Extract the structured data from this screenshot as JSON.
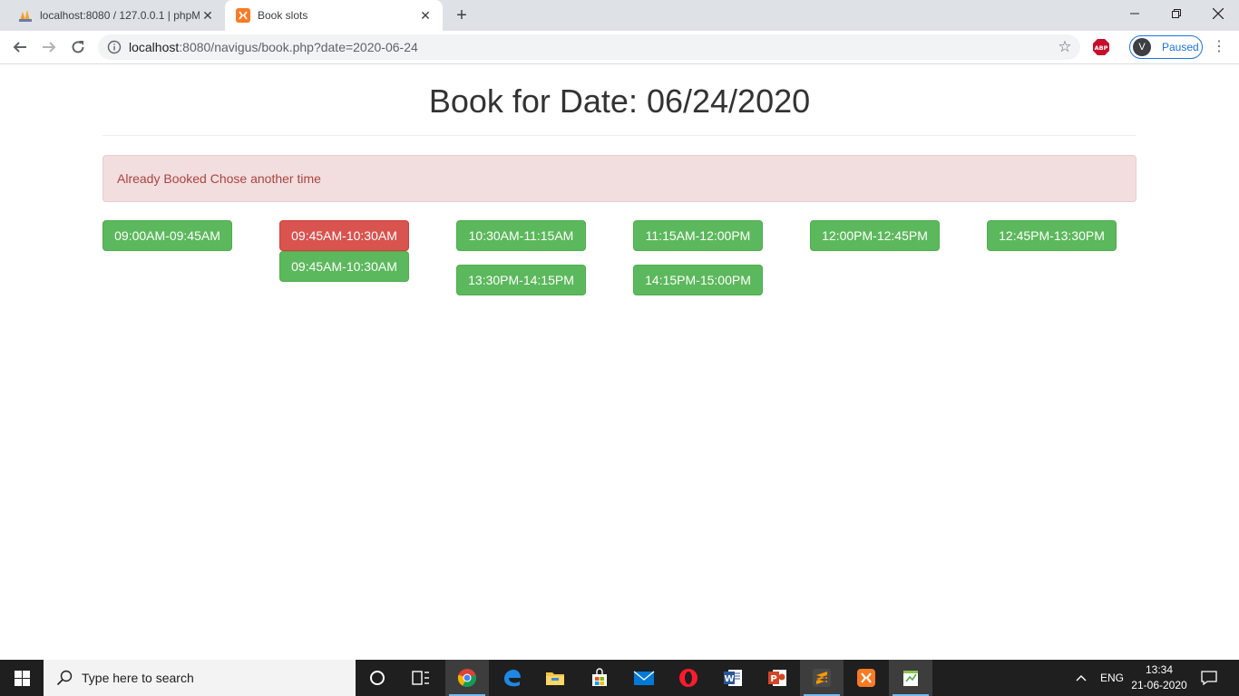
{
  "browser": {
    "tabs": [
      {
        "title": "localhost:8080 / 127.0.0.1 | phpMyAdmin",
        "active": false
      },
      {
        "title": "Book slots",
        "active": true
      }
    ],
    "url_host": "localhost",
    "url_rest": ":8080/navigus/book.php?date=2020-06-24",
    "profile_initial": "V",
    "profile_status": "Paused",
    "abp_label": "ABP"
  },
  "page": {
    "heading": "Book for Date: 06/24/2020",
    "alert": "Already Booked Chose another time",
    "slots": [
      {
        "label": "09:00AM-09:45AM",
        "status": "available",
        "color": "#5cb85c"
      },
      {
        "label": "09:45AM-10:30AM",
        "status": "booked",
        "color": "#d9534f"
      },
      {
        "label": "09:45AM-10:30AM",
        "status": "available",
        "color": "#5cb85c"
      },
      {
        "label": "10:30AM-11:15AM",
        "status": "available",
        "color": "#5cb85c"
      },
      {
        "label": "13:30PM-14:15PM",
        "status": "available",
        "color": "#5cb85c"
      },
      {
        "label": "11:15AM-12:00PM",
        "status": "available",
        "color": "#5cb85c"
      },
      {
        "label": "14:15PM-15:00PM",
        "status": "available",
        "color": "#5cb85c"
      },
      {
        "label": "12:00PM-12:45PM",
        "status": "available",
        "color": "#5cb85c"
      },
      {
        "label": "12:45PM-13:30PM",
        "status": "available",
        "color": "#5cb85c"
      }
    ]
  },
  "taskbar": {
    "search_placeholder": "Type here to search",
    "language": "ENG",
    "time": "13:34",
    "date": "21-06-2020",
    "apps": [
      "cortana-icon",
      "task-view-icon",
      "chrome-icon",
      "edge-icon",
      "file-explorer-icon",
      "store-icon",
      "mail-icon",
      "opera-icon",
      "word-icon",
      "powerpoint-icon",
      "sublime-text-icon",
      "xampp-icon",
      "notepad-plus-icon"
    ]
  }
}
